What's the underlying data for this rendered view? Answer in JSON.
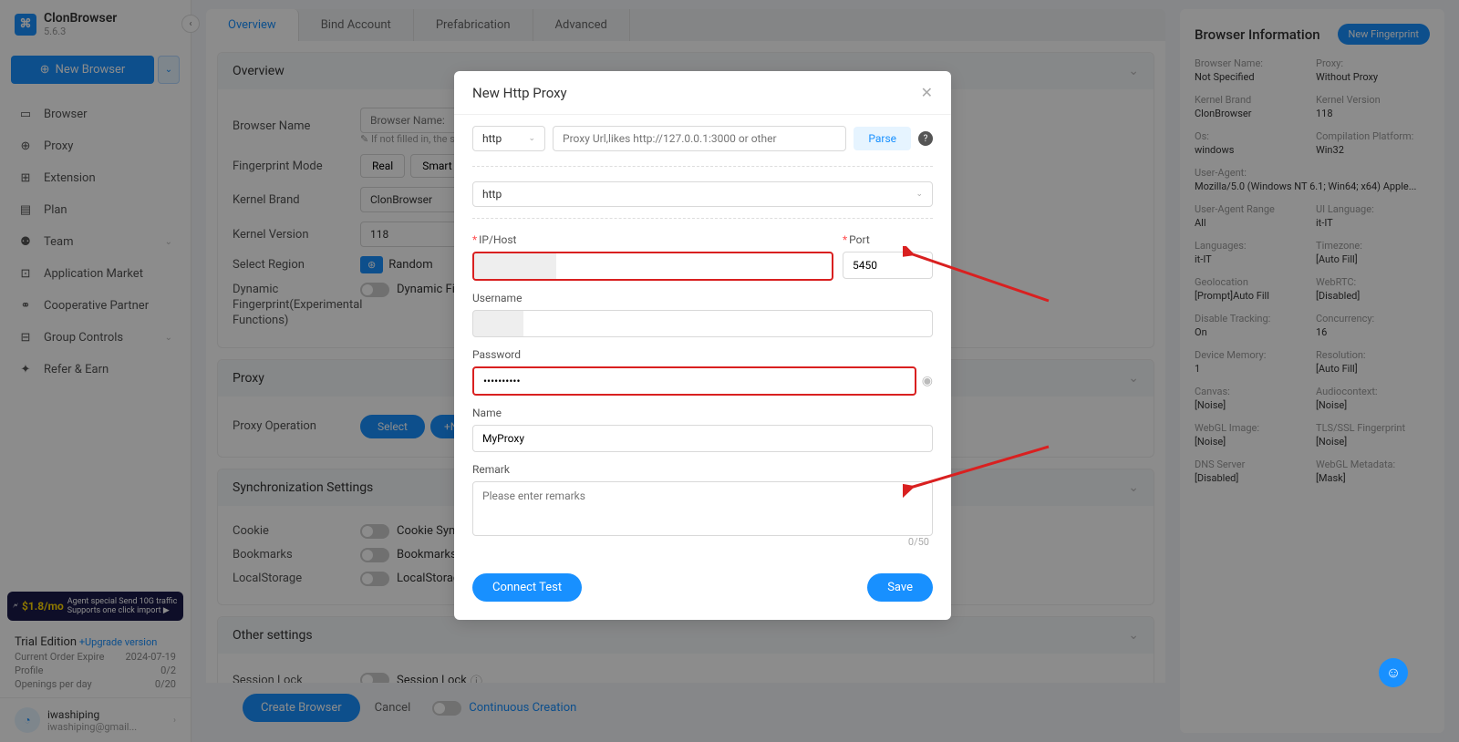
{
  "app": {
    "name": "ClonBrowser",
    "version": "5.6.3",
    "newBrowser": "New Browser"
  },
  "nav": {
    "items": [
      {
        "label": "Browser",
        "icon": "▭"
      },
      {
        "label": "Proxy",
        "icon": "⊕"
      },
      {
        "label": "Extension",
        "icon": "⊞"
      },
      {
        "label": "Plan",
        "icon": "▤"
      },
      {
        "label": "Team",
        "icon": "⚉",
        "chev": true
      },
      {
        "label": "Application Market",
        "icon": "⊡"
      },
      {
        "label": "Cooperative Partner",
        "icon": "⚭"
      },
      {
        "label": "Group Controls",
        "icon": "⊟",
        "chev": true
      },
      {
        "label": "Refer & Earn",
        "icon": "✦"
      }
    ]
  },
  "promo": {
    "price": "$1.8/mo",
    "line1": "Agent special Send 10G traffic",
    "line2": "Supports one click import ▶"
  },
  "trial": {
    "title": "Trial Edition",
    "upgrade": "+Upgrade version",
    "rows": [
      {
        "l": "Current Order Expire",
        "r": "2024-07-19"
      },
      {
        "l": "Profile",
        "r": "0/2"
      },
      {
        "l": "Openings per day",
        "r": "0/20"
      }
    ]
  },
  "user": {
    "name": "iwashiping",
    "email": "iwashiping@gmail..."
  },
  "tabs": [
    "Overview",
    "Bind Account",
    "Prefabrication",
    "Advanced"
  ],
  "overview": {
    "title": "Overview",
    "browserNameLabel": "Browser Name",
    "browserNamePlaceholder": "Browser Name:",
    "browserNameHint": "✎ If not filled in, the sy",
    "fingerprintModeLabel": "Fingerprint Mode",
    "modes": [
      "Real",
      "Smart"
    ],
    "kernelBrandLabel": "Kernel Brand",
    "kernelBrandValue": "ClonBrowser",
    "kernelVersionLabel": "Kernel Version",
    "kernelVersionValue": "118",
    "selectRegionLabel": "Select Region",
    "randomLabel": "Random",
    "dynFPLabel": "Dynamic Fingerprint(Experimental Functions)",
    "dynFPToggleLabel": "Dynamic Fin"
  },
  "proxyPanel": {
    "title": "Proxy",
    "operationLabel": "Proxy Operation",
    "select": "Select",
    "new": "+Ne"
  },
  "syncPanel": {
    "title": "Synchronization Settings",
    "rows": [
      {
        "l": "Cookie",
        "t": "Cookie Sync"
      },
      {
        "l": "Bookmarks",
        "t": "Bookmarks S"
      },
      {
        "l": "LocalStorage",
        "t": "LocalStorage"
      }
    ]
  },
  "otherPanel": {
    "title": "Other settings",
    "sessionLock": "Session Lock",
    "sessionLockToggle": "Session Lock"
  },
  "footer": {
    "create": "Create Browser",
    "cancel": "Cancel",
    "continuous": "Continuous Creation"
  },
  "rightPanel": {
    "title": "Browser Information",
    "newFp": "New Fingerprint",
    "items": [
      {
        "l": "Browser Name:",
        "v": "Not Specified"
      },
      {
        "l": "Proxy:",
        "v": "Without Proxy"
      },
      {
        "l": "Kernel Brand",
        "v": "ClonBrowser"
      },
      {
        "l": "Kernel Version",
        "v": "118"
      },
      {
        "l": "Os:",
        "v": "windows"
      },
      {
        "l": "Compilation Platform:",
        "v": "Win32"
      },
      {
        "l": "User-Agent:",
        "v": "Mozilla/5.0 (Windows NT 6.1; Win64; x64) Apple...",
        "span2": true
      },
      {
        "l": "User-Agent Range",
        "v": "All"
      },
      {
        "l": "UI Language:",
        "v": "it-IT"
      },
      {
        "l": "Languages:",
        "v": "it-IT"
      },
      {
        "l": "Timezone:",
        "v": "[Auto Fill]"
      },
      {
        "l": "Geolocation",
        "v": "[Prompt]Auto Fill"
      },
      {
        "l": "WebRTC:",
        "v": "[Disabled]"
      },
      {
        "l": "Disable Tracking:",
        "v": "On"
      },
      {
        "l": "Concurrency:",
        "v": "16"
      },
      {
        "l": "Device Memory:",
        "v": "1"
      },
      {
        "l": "Resolution:",
        "v": "[Auto Fill]"
      },
      {
        "l": "Canvas:",
        "v": "[Noise]"
      },
      {
        "l": "Audiocontext:",
        "v": "[Noise]"
      },
      {
        "l": "WebGL Image:",
        "v": "[Noise]"
      },
      {
        "l": "TLS/SSL Fingerprint",
        "v": "[Noise]"
      },
      {
        "l": "DNS Server",
        "v": "[Disabled]"
      },
      {
        "l": "WebGL Metadata:",
        "v": "[Mask]"
      }
    ]
  },
  "modal": {
    "title": "New Http Proxy",
    "proto": "http",
    "protoFull": "http",
    "parseInputPlaceholder": "Proxy Url,likes http://127.0.0.1:3000 or other",
    "parse": "Parse",
    "ipLabel": "IP/Host",
    "ipValue": "",
    "portLabel": "Port",
    "portValue": "5450",
    "usernameLabel": "Username",
    "usernameValue": "",
    "passwordLabel": "Password",
    "passwordValue": "••••••••••",
    "nameLabel": "Name",
    "nameValue": "MyProxy",
    "remarkLabel": "Remark",
    "remarkPlaceholder": "Please enter remarks",
    "remarkCount": "0/50",
    "connectTest": "Connect Test",
    "save": "Save"
  }
}
